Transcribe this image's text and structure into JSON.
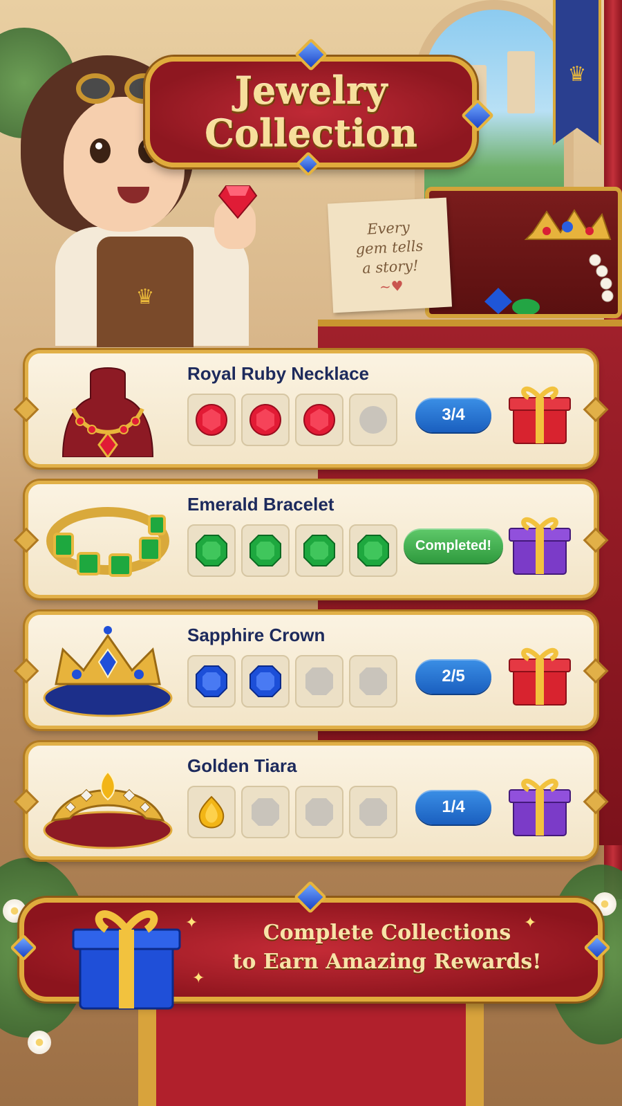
{
  "title": {
    "line1": "Jewelry",
    "line2": "Collection"
  },
  "note": {
    "line1": "Every",
    "line2": "gem tells",
    "line3": "a story!"
  },
  "collections": [
    {
      "name": "Royal Ruby Necklace",
      "progress_text": "3/4",
      "collected": 3,
      "total_slots_shown": 4,
      "gem_color": "#e21b35",
      "status": "in-progress",
      "gift_color": "#d8232f"
    },
    {
      "name": "Emerald Bracelet",
      "progress_text": "Completed!",
      "collected": 4,
      "total_slots_shown": 4,
      "gem_color": "#1ea83f",
      "status": "completed",
      "gift_color": "#7b3bc8"
    },
    {
      "name": "Sapphire Crown",
      "progress_text": "2/5",
      "collected": 2,
      "total_slots_shown": 4,
      "gem_color": "#1c4fd8",
      "status": "in-progress",
      "gift_color": "#d8232f"
    },
    {
      "name": "Golden Tiara",
      "progress_text": "1/4",
      "collected": 1,
      "total_slots_shown": 4,
      "gem_color": "#f2b516",
      "status": "in-progress",
      "gift_color": "#7b3bc8"
    }
  ],
  "reward_banner": {
    "line1": "Complete Collections",
    "line2": "to Earn Amazing Rewards!"
  },
  "colors": {
    "plaque_red": "#a41e29",
    "gold_trim": "#e1b048",
    "pill_blue": "#2a76d6",
    "pill_green": "#3db04e",
    "title_ink": "#1d2a5c"
  }
}
